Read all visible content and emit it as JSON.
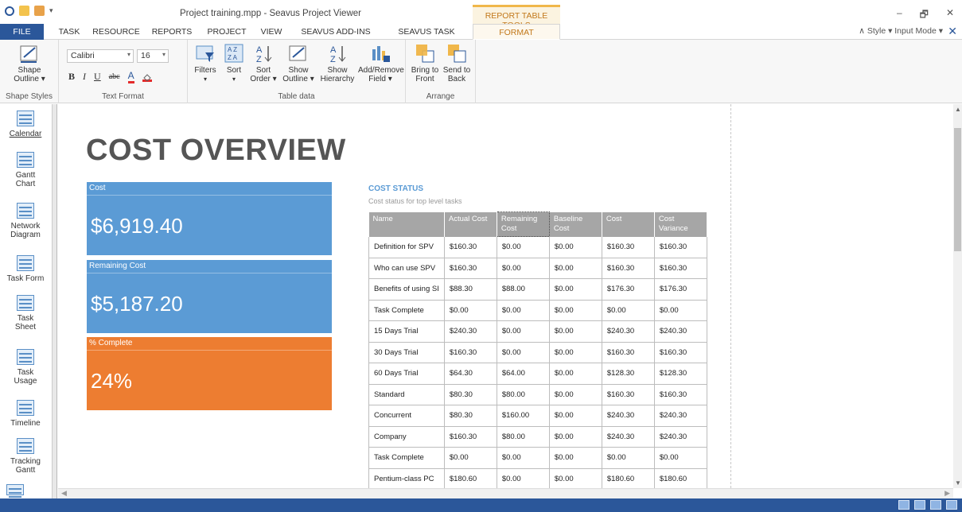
{
  "window": {
    "title": "Project training.mpp - Seavus Project Viewer",
    "context_header": "REPORT TABLE TOOLS",
    "controls": [
      "–",
      "🗗",
      "✕"
    ]
  },
  "tabs": {
    "file": "FILE",
    "items": [
      "TASK",
      "RESOURCE",
      "REPORTS",
      "PROJECT",
      "VIEW",
      "SEAVUS ADD-INS",
      "SEAVUS TASK UPDATE"
    ],
    "format": "FORMAT",
    "right": "∧ Style ▾ Input Mode ▾",
    "close": "✕"
  },
  "ribbon": {
    "shape_outline": "Shape Outline ▾",
    "font_name": "Calibri",
    "font_size": "16",
    "bold": "B",
    "italic": "I",
    "underline": "U",
    "strike": "abc",
    "font_color": "A",
    "filters": "Filters",
    "sort": "Sort",
    "sort_order": "Sort Order ▾",
    "show_outline": "Show Outline ▾",
    "show_hierarchy": "Show Hierarchy",
    "add_remove_field": "Add/Remove Field ▾",
    "bring_to_front": "Bring to Front",
    "send_to_back": "Send to Back",
    "groups": {
      "shape_styles": "Shape Styles",
      "text_format": "Text Format",
      "table_data": "Table data",
      "arrange": "Arrange"
    }
  },
  "leftnav": [
    {
      "label": "Calendar"
    },
    {
      "label": "Gantt Chart"
    },
    {
      "label": "Network Diagram"
    },
    {
      "label": "Task Form"
    },
    {
      "label": "Task Sheet"
    },
    {
      "label": "Task Usage"
    },
    {
      "label": "Timeline"
    },
    {
      "label": "Tracking Gantt"
    }
  ],
  "report": {
    "title": "COST OVERVIEW",
    "kpis": [
      {
        "label": "Cost",
        "value": "$6,919.40"
      },
      {
        "label": "Remaining Cost",
        "value": "$5,187.20"
      },
      {
        "label": "% Complete",
        "value": "24%"
      }
    ],
    "cost_status_title": "COST STATUS",
    "cost_status_subtitle": "Cost status for top level tasks",
    "table": {
      "headers": [
        "Name",
        "Actual Cost",
        "Remaining Cost",
        "Baseline Cost",
        "Cost",
        "Cost Variance"
      ],
      "rows": [
        [
          "Definition for SPV",
          "$160.30",
          "$0.00",
          "$0.00",
          "$160.30",
          "$160.30"
        ],
        [
          "Who can use SPV",
          "$160.30",
          "$0.00",
          "$0.00",
          "$160.30",
          "$160.30"
        ],
        [
          "Benefits of using SI",
          "$88.30",
          "$88.00",
          "$0.00",
          "$176.30",
          "$176.30"
        ],
        [
          "Task Complete",
          "$0.00",
          "$0.00",
          "$0.00",
          "$0.00",
          "$0.00"
        ],
        [
          "15 Days Trial",
          "$240.30",
          "$0.00",
          "$0.00",
          "$240.30",
          "$240.30"
        ],
        [
          "30 Days Trial",
          "$160.30",
          "$0.00",
          "$0.00",
          "$160.30",
          "$160.30"
        ],
        [
          "60 Days Trial",
          "$64.30",
          "$64.00",
          "$0.00",
          "$128.30",
          "$128.30"
        ],
        [
          "Standard",
          "$80.30",
          "$80.00",
          "$0.00",
          "$160.30",
          "$160.30"
        ],
        [
          "Concurrent",
          "$80.30",
          "$160.00",
          "$0.00",
          "$240.30",
          "$240.30"
        ],
        [
          "Company",
          "$160.30",
          "$80.00",
          "$0.00",
          "$240.30",
          "$240.30"
        ],
        [
          "Task Complete",
          "$0.00",
          "$0.00",
          "$0.00",
          "$0.00",
          "$0.00"
        ],
        [
          "Pentium-class PC",
          "$180.60",
          "$0.00",
          "$0.00",
          "$180.60",
          "$180.60"
        ]
      ]
    }
  },
  "colors": {
    "accent": "#2b579a",
    "kpi_blue": "#5b9bd5",
    "kpi_orange": "#ed7d31",
    "context": "#c2781a"
  }
}
